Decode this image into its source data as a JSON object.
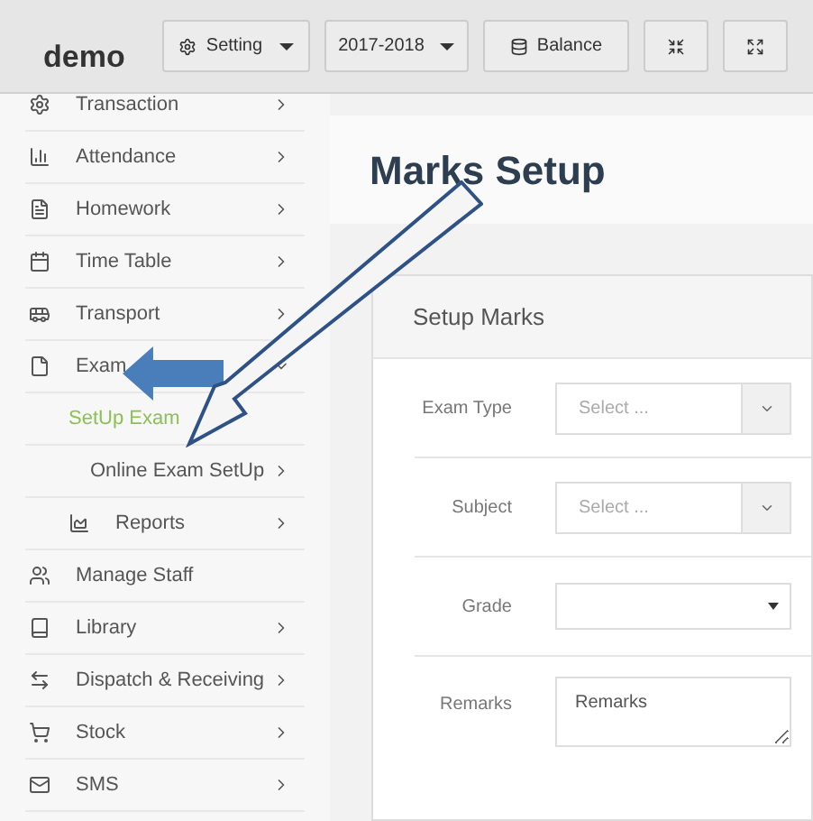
{
  "header": {
    "brand": "demo",
    "buttons": [
      {
        "kind": "menu",
        "label": "Setting"
      },
      {
        "kind": "menu",
        "label": "2017-2018"
      },
      {
        "kind": "plain",
        "label": "Balance"
      },
      {
        "kind": "icon"
      },
      {
        "kind": "icon"
      }
    ]
  },
  "sidebar": {
    "items": [
      {
        "label": "Transaction",
        "has_arrow": true,
        "expanded": false,
        "selected": false
      },
      {
        "label": "Attendance",
        "has_arrow": true,
        "expanded": false,
        "selected": false
      },
      {
        "label": "Homework",
        "has_arrow": true,
        "expanded": false,
        "selected": false
      },
      {
        "label": "Time Table",
        "has_arrow": true,
        "expanded": false,
        "selected": false
      },
      {
        "label": "Transport",
        "has_arrow": true,
        "expanded": false,
        "selected": false
      },
      {
        "label": "Exam",
        "has_arrow": true,
        "expanded": true,
        "selected": false,
        "children": [
          {
            "label": "SetUp Exam",
            "has_arrow": false,
            "selected": true
          },
          {
            "label": "Online Exam SetUp",
            "has_arrow": true,
            "expanded": false,
            "selected": false
          },
          {
            "label": "Reports",
            "has_arrow": true,
            "expanded": false,
            "selected": false
          }
        ]
      },
      {
        "label": "Manage Staff",
        "has_arrow": false,
        "selected": false
      },
      {
        "label": "Library",
        "has_arrow": true,
        "expanded": false,
        "selected": false
      },
      {
        "label": "Dispatch & Receiving",
        "has_arrow": true,
        "expanded": false,
        "selected": false
      },
      {
        "label": "Stock",
        "has_arrow": true,
        "expanded": false,
        "selected": false
      },
      {
        "label": "SMS",
        "has_arrow": true,
        "expanded": false,
        "selected": false
      }
    ]
  },
  "page": {
    "title": "Marks Setup"
  },
  "card": {
    "title": "Setup Marks",
    "fields": [
      {
        "label": "Exam Type",
        "kind": "addon-select",
        "placeholder": "Select ..."
      },
      {
        "label": "Subject",
        "kind": "addon-select",
        "placeholder": "Select ..."
      },
      {
        "label": "Grade",
        "kind": "select"
      },
      {
        "label": "Remarks",
        "kind": "textarea",
        "placeholder": "Remarks"
      }
    ]
  }
}
